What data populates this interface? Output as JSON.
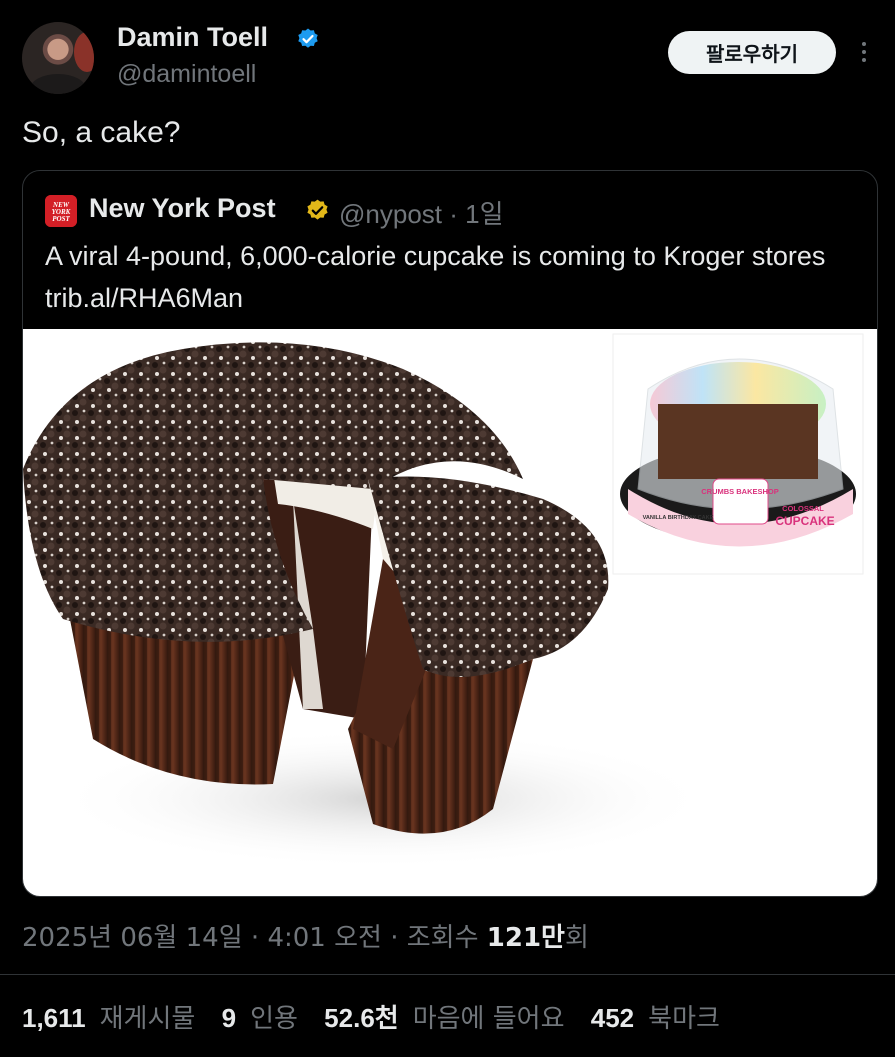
{
  "author": {
    "name": "Damin Toell",
    "handle": "@damintoell"
  },
  "follow_label": "팔로우하기",
  "tweet_text": "So, a cake?",
  "quoted": {
    "logo_text": "NEW YORK POST",
    "name": "New York Post",
    "handle": "@nypost",
    "separator": "·",
    "age": "1일",
    "body": "A viral 4-pound, 6,000-calorie cupcake is coming to Kroger stores trib.al/RHA6Man",
    "product_label": {
      "brand": "CRUMBS BAKESHOP",
      "left": "VANILLA BIRTHDAY CAKE",
      "right_top": "COLOSSAL",
      "right_main": "CUPCAKE"
    }
  },
  "meta": {
    "date": "2025년 06월 14일",
    "sep1": " · ",
    "time": "4:01 오전",
    "sep2": " · ",
    "views_label": "조회수 ",
    "views_value": "121만",
    "views_suffix": "회"
  },
  "stats": {
    "reposts_value": "1,611",
    "reposts_label": "재게시물",
    "quotes_value": "9",
    "quotes_label": "인용",
    "likes_value": "52.6천",
    "likes_label": "마음에 들어요",
    "bookmarks_value": "452",
    "bookmarks_label": "북마크"
  },
  "colors": {
    "background": "#000000",
    "verified_blue": "#1d9bf0",
    "verified_gold": "#e2b719",
    "nypost_red": "#d31f26",
    "muted_text": "#71767b"
  }
}
